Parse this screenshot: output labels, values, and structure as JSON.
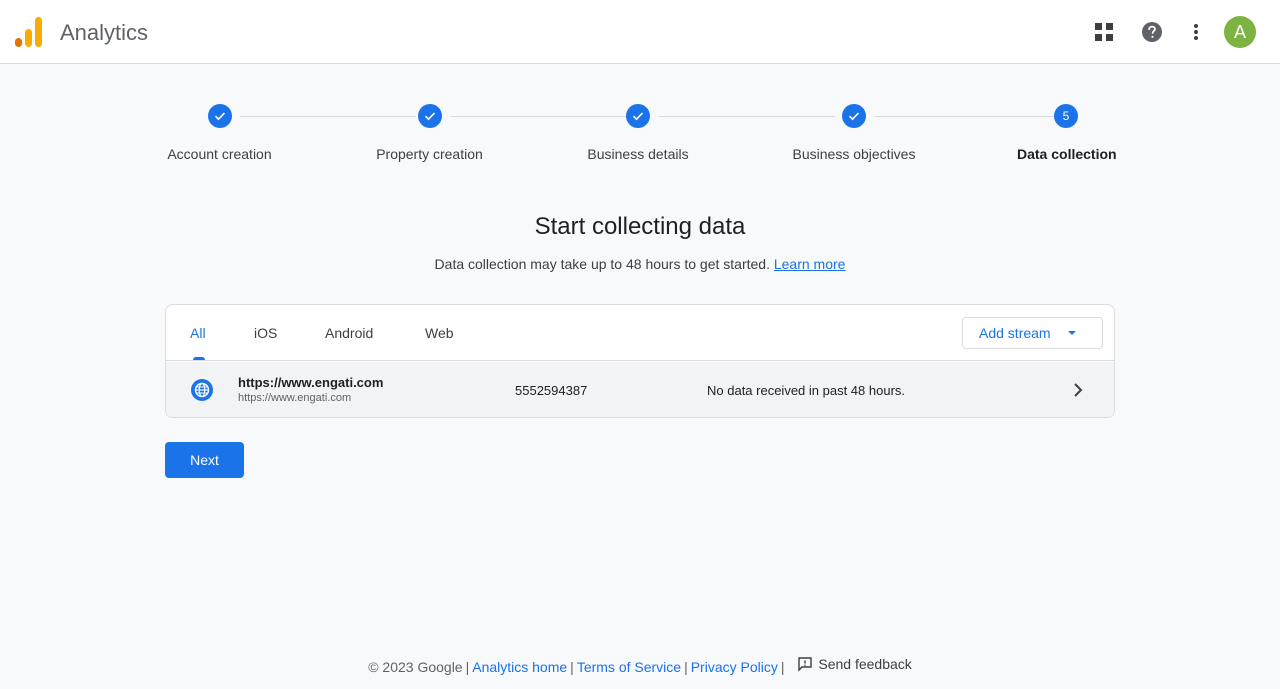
{
  "header": {
    "app_title": "Analytics",
    "avatar_letter": "A",
    "logo_colors": [
      "#F9AB00",
      "#E37400"
    ]
  },
  "stepper": {
    "steps": [
      {
        "label": "Account creation",
        "state": "done"
      },
      {
        "label": "Property creation",
        "state": "done"
      },
      {
        "label": "Business details",
        "state": "done"
      },
      {
        "label": "Business objectives",
        "state": "done"
      },
      {
        "label": "Data collection",
        "state": "active",
        "number": "5"
      }
    ]
  },
  "main": {
    "title": "Start collecting data",
    "subtitle": "Data collection may take up to 48 hours to get started.",
    "learn_more": "Learn more"
  },
  "streams_card": {
    "tabs": [
      "All",
      "iOS",
      "Android",
      "Web"
    ],
    "active_tab": "All",
    "add_stream_label": "Add stream",
    "rows": [
      {
        "name": "https://www.engati.com",
        "url": "https://www.engati.com",
        "stream_id": "5552594387",
        "status": "No data received in past 48 hours."
      }
    ]
  },
  "next_label": "Next",
  "footer": {
    "copyright": "© 2023 Google",
    "links": [
      "Analytics home",
      "Terms of Service",
      "Privacy Policy"
    ],
    "feedback": "Send feedback"
  },
  "colors": {
    "accent": "#1a73e8",
    "avatar_bg": "#7cb342"
  }
}
